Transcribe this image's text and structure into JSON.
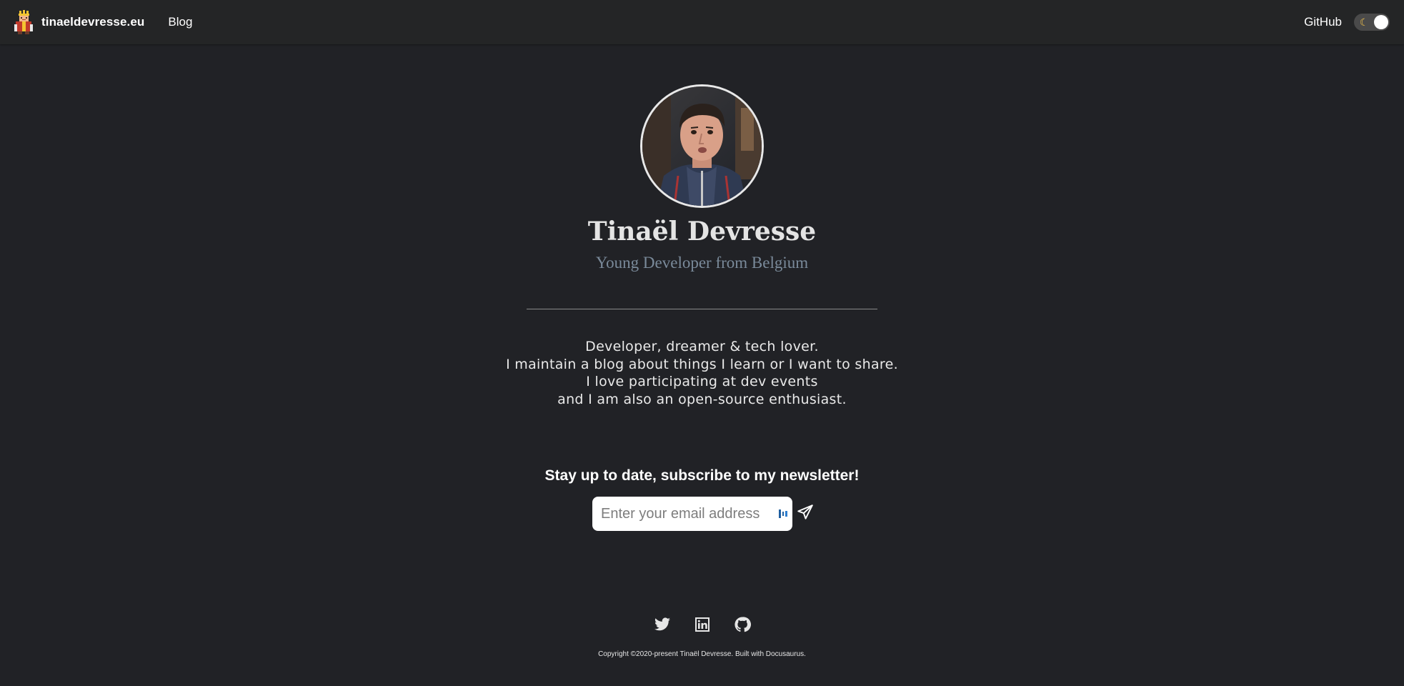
{
  "navbar": {
    "brand_title": "tinaeldevresse.eu",
    "links": [
      {
        "label": "Blog"
      }
    ],
    "right_links": [
      {
        "label": "GitHub"
      }
    ],
    "theme_toggle": {
      "icon": "moon-icon",
      "state": "dark"
    }
  },
  "hero": {
    "avatar": "profile-photo",
    "name": "Tinaël Devresse",
    "tagline": "Young Developer from Belgium",
    "bio_lines": [
      "Developer, dreamer & tech lover.",
      "I maintain a blog about things I learn or I want to share.",
      "I love participating at dev events",
      "and I am also an open-source enthusiast."
    ]
  },
  "newsletter": {
    "title": "Stay up to date, subscribe to my newsletter!",
    "placeholder": "Enter your email address",
    "value": "",
    "send_icon": "paper-plane-icon"
  },
  "footer": {
    "social": [
      {
        "name": "twitter-icon"
      },
      {
        "name": "linkedin-icon"
      },
      {
        "name": "github-icon"
      }
    ],
    "copyright": "Copyright ©2020-present Tinaël Devresse. Built with Docusaurus."
  },
  "colors": {
    "background": "#212226",
    "navbar": "#242526",
    "tagline": "#7a8a9a",
    "text": "#e3e3e3"
  }
}
